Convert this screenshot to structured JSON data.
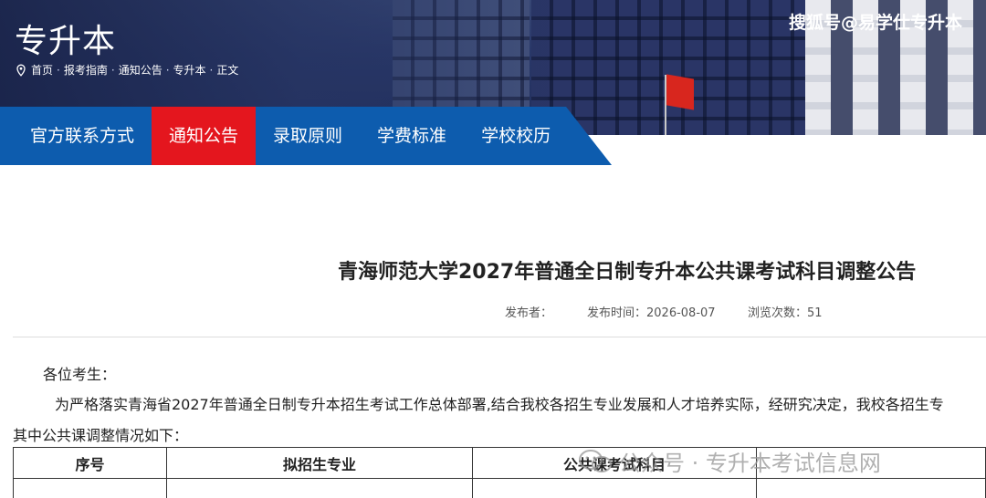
{
  "banner": {
    "title": "专升本",
    "watermark": "搜狐号@易学仕专升本",
    "breadcrumb": [
      "首页",
      "报考指南",
      "通知公告",
      "专升本",
      "正文"
    ],
    "icons": {
      "breadcrumb": "map-pin-icon"
    }
  },
  "nav": {
    "items": [
      {
        "label": "官方联系方式",
        "active": false
      },
      {
        "label": "通知公告",
        "active": true
      },
      {
        "label": "录取原则",
        "active": false
      },
      {
        "label": "学费标准",
        "active": false
      },
      {
        "label": "学校校历",
        "active": false
      }
    ],
    "colors": {
      "bar": "#0d5cae",
      "active": "#e4161e"
    }
  },
  "article": {
    "title": "青海师范大学2027年普通全日制专升本公共课考试科目调整公告",
    "meta": {
      "publisher": "发布者：",
      "date": "发布时间：2026-08-07",
      "views": "浏览次数：51"
    },
    "greeting": "各位考生：",
    "paragraph1": "为严格落实青海省2027年普通全日制专升本招生考试工作总体部署,结合我校各招生专业发展和人才培养实际，经研究决定，我校各招生专",
    "paragraph2": "其中公共课调整情况如下："
  },
  "table": {
    "headers": [
      "序号",
      "拟招生专业",
      "公共课考试科目",
      ""
    ]
  },
  "watermark_bottom": {
    "text": "公众号 · 专升本考试信息网",
    "icon": "wechat-icon"
  }
}
